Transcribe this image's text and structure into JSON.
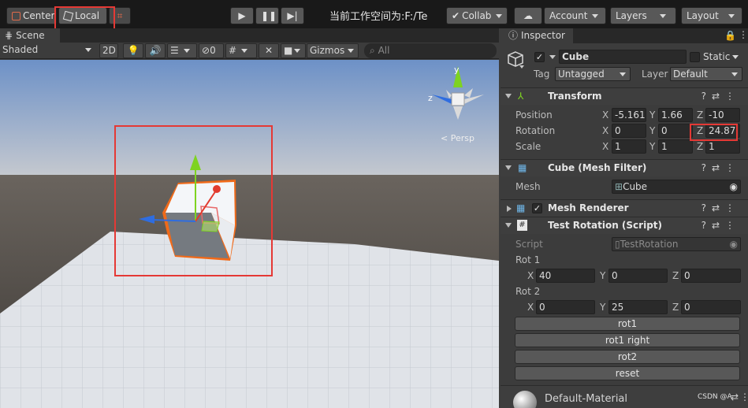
{
  "toolbar": {
    "center_label": "Center",
    "local_label": "Local",
    "project_path": "当前工作空间为:F:/Te",
    "collab_label": "Collab",
    "account_label": "Account",
    "layers_label": "Layers",
    "layout_label": "Layout"
  },
  "scene": {
    "tab_label": "Scene",
    "shading_mode": "Shaded",
    "mode_2d": "2D",
    "hidden_count": "0",
    "gizmos_label": "Gizmos",
    "search_placeholder": "All",
    "gizmo_y": "y",
    "gizmo_z": "z",
    "persp_label": "< Persp"
  },
  "inspector": {
    "tab_label": "Inspector",
    "object_name": "Cube",
    "static_label": "Static",
    "tag_label": "Tag",
    "tag_value": "Untagged",
    "layer_label": "Layer",
    "layer_value": "Default",
    "transform": {
      "title": "Transform",
      "position_label": "Position",
      "rotation_label": "Rotation",
      "scale_label": "Scale",
      "position": {
        "x": "-5.1617",
        "y": "1.66",
        "z": "-10"
      },
      "rotation": {
        "x": "0",
        "y": "0",
        "z": "24.87"
      },
      "scale": {
        "x": "1",
        "y": "1",
        "z": "1"
      }
    },
    "mesh_filter": {
      "title": "Cube (Mesh Filter)",
      "mesh_label": "Mesh",
      "mesh_value": "Cube"
    },
    "mesh_renderer": {
      "title": "Mesh Renderer"
    },
    "script": {
      "title": "Test Rotation (Script)",
      "script_label": "Script",
      "script_value": "TestRotation",
      "rot1_label": "Rot 1",
      "rot1": {
        "x": "40",
        "y": "0",
        "z": "0"
      },
      "rot2_label": "Rot 2",
      "rot2": {
        "x": "0",
        "y": "25",
        "z": "0"
      },
      "buttons": [
        "rot1",
        "rot1 right",
        "rot2",
        "reset"
      ]
    },
    "material_name": "Default-Material"
  },
  "axis_labels": {
    "x": "X",
    "y": "Y",
    "z": "Z"
  },
  "watermark": "CSDN @A",
  "colors": {
    "selection_outline": "#f06a1a",
    "highlight_box": "#e53935",
    "axis_x": "#e23b2e",
    "axis_y": "#7ed321",
    "axis_z": "#2f6de0"
  }
}
